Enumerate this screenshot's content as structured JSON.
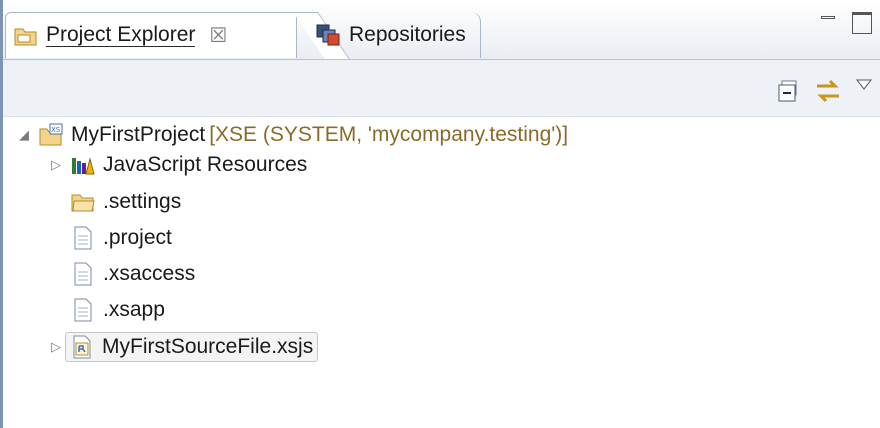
{
  "tabs": [
    {
      "label": "Project Explorer",
      "icon": "project-explorer-icon",
      "close": "☒",
      "active": true
    },
    {
      "label": "Repositories",
      "icon": "repositories-icon",
      "active": false
    }
  ],
  "view_toolbar": {
    "icons": [
      "collapse-all-icon",
      "link-with-editor-icon",
      "view-menu-icon"
    ]
  },
  "tree": [
    {
      "label": "MyFirstProject",
      "decoration": "[XSE (SYSTEM, 'mycompany.testing')]",
      "icon": "xs-project-icon",
      "expanded": true,
      "level": 0
    },
    {
      "label": "JavaScript Resources",
      "icon": "javascript-resources-icon",
      "expanded": false,
      "level": 1
    },
    {
      "label": ".settings",
      "icon": "folder-icon",
      "level": 1
    },
    {
      "label": ".project",
      "icon": "file-icon",
      "level": 1
    },
    {
      "label": ".xsaccess",
      "icon": "file-icon",
      "level": 1
    },
    {
      "label": ".xsapp",
      "icon": "file-icon",
      "level": 1
    },
    {
      "label": "MyFirstSourceFile.xsjs",
      "icon": "xsjs-file-icon",
      "expanded": false,
      "level": 1,
      "selected": true
    }
  ],
  "colors": {
    "decoration": "#8a6a28",
    "frame": "#7d94b4"
  }
}
